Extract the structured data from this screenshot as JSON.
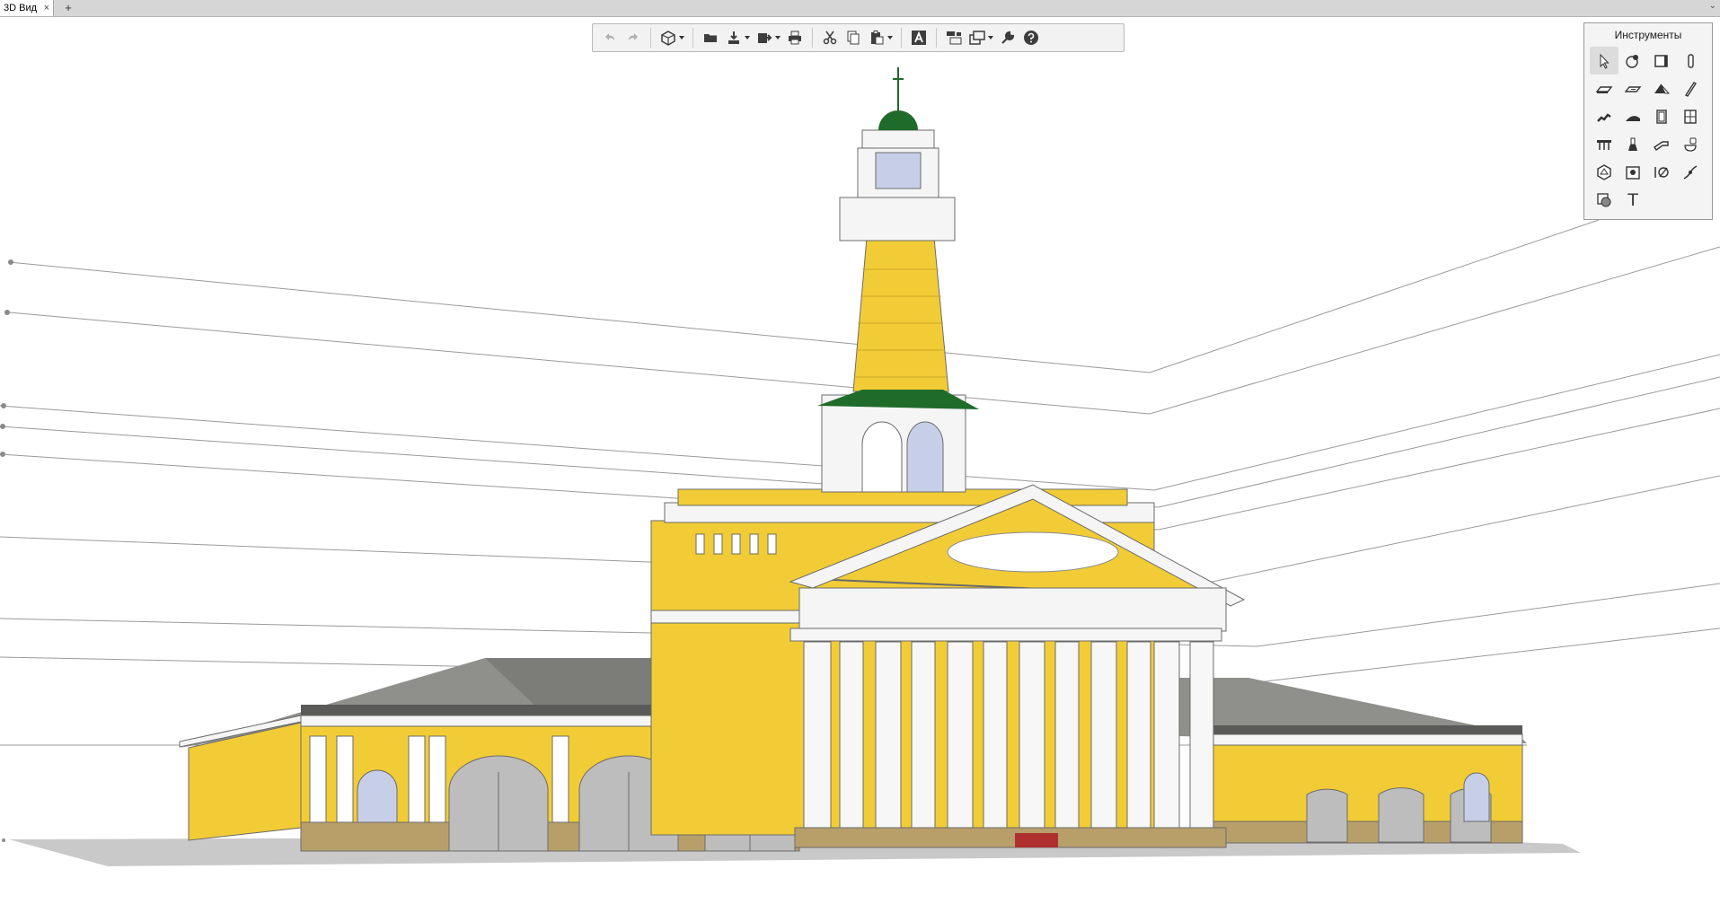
{
  "tabs": [
    {
      "label": "3D Вид"
    }
  ],
  "tab_close_glyph": "×",
  "tab_add_glyph": "+",
  "collapse_glyph": "⌄",
  "toolbar": {
    "buttons": [
      {
        "name": "undo",
        "icon": "undo-icon",
        "enabled": false
      },
      {
        "name": "redo",
        "icon": "redo-icon",
        "enabled": false
      },
      {
        "name": "3d-views",
        "icon": "3d-view-icon",
        "dropdown": true
      },
      {
        "name": "open",
        "icon": "folder-icon"
      },
      {
        "name": "save",
        "icon": "save-icon",
        "dropdown": true
      },
      {
        "name": "export",
        "icon": "export-icon",
        "dropdown": true
      },
      {
        "name": "print",
        "icon": "print-icon"
      },
      {
        "name": "cut",
        "icon": "cut-icon"
      },
      {
        "name": "copy",
        "icon": "copy-icon"
      },
      {
        "name": "paste",
        "icon": "paste-icon",
        "dropdown": true
      },
      {
        "name": "text-style",
        "icon": "text-style-icon"
      },
      {
        "name": "layers",
        "icon": "layers-icon"
      },
      {
        "name": "views",
        "icon": "views-icon",
        "dropdown": true
      },
      {
        "name": "settings",
        "icon": "wrench-icon"
      },
      {
        "name": "help",
        "icon": "help-icon"
      }
    ]
  },
  "palette": {
    "title": "Инструменты",
    "text_tool_glyph": "T",
    "tools": [
      "select",
      "construction",
      "wall",
      "column",
      "slab",
      "floor",
      "roof",
      "beam",
      "stair",
      "ramp",
      "door",
      "window",
      "railing",
      "lamp",
      "pipe",
      "fixture",
      "object",
      "zone",
      "dimension",
      "section",
      "hatch",
      "text"
    ]
  },
  "scene": {
    "background": "#ffffff",
    "facade_color": "#f2cc36",
    "trim_color": "#ffffff",
    "roof_color": "#8a8a86",
    "dome_color": "#1f6b2a",
    "ground_color": "#c8c8c8",
    "plinth_color": "#b89f6a"
  }
}
